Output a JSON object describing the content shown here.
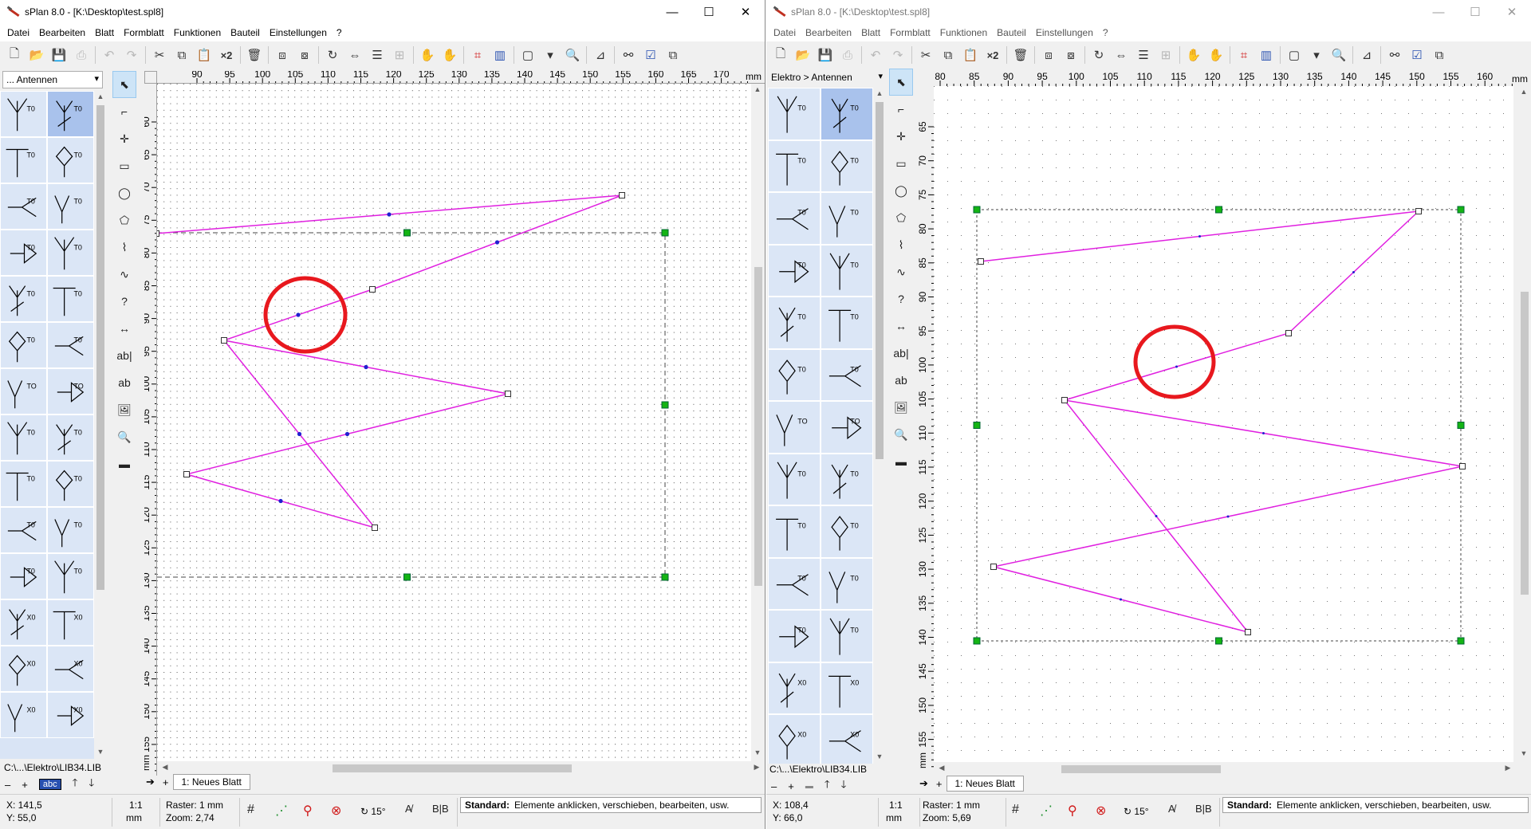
{
  "colors": {
    "polyline": "#e020e0",
    "highlight": "#e8181e",
    "handle_green": "#14b414",
    "node_blue": "#2020d0"
  },
  "menu": [
    "Datei",
    "Bearbeiten",
    "Blatt",
    "Formblatt",
    "Funktionen",
    "Bauteil",
    "Einstellungen",
    "?"
  ],
  "icons": [
    "new",
    "open",
    "save",
    "print",
    "undo",
    "redo",
    "cut",
    "copy",
    "paste",
    "duplicate",
    "delete",
    "to-front",
    "to-back",
    "rotate",
    "mirror",
    "align",
    "group",
    "ungroup",
    "snap",
    "align-grid",
    "frame",
    "zoom",
    "bom",
    "find",
    "checklist",
    "pages"
  ],
  "left": {
    "title": "sPlan 8.0 - [K:\\Desktop\\test.spl8]",
    "library": "... Antennen",
    "lib_path": "C:\\...\\Elektro\\LIB34.LIB",
    "lib_btn": "abc",
    "ruler_x": [
      "90",
      "95",
      "100",
      "105",
      "110",
      "115",
      "120",
      "125",
      "130",
      "135",
      "140",
      "145",
      "150",
      "155",
      "160",
      "165",
      "170"
    ],
    "ruler_y": [
      "60",
      "65",
      "70",
      "75",
      "80",
      "85",
      "90",
      "95",
      "100",
      "105",
      "110",
      "115",
      "120",
      "125",
      "130",
      "135",
      "140",
      "145",
      "150",
      "155"
    ],
    "unit": "mm",
    "sheet": "1: Neues Blatt",
    "coord_x": "X:    141,5",
    "coord_y": "Y:      55,0",
    "scale": "1:1",
    "scale_unit": "mm",
    "raster": "Raster: 1 mm",
    "zoom": "Zoom: 2,74",
    "angle": "15°",
    "status_label": "Standard:",
    "status_text": "Elemente anklicken, verschieben, bearbeiten, usw."
  },
  "right": {
    "title": "sPlan 8.0 - [K:\\Desktop\\test.spl8]",
    "library": "Elektro > Antennen",
    "lib_path": "C:\\...\\Elektro\\LIB34.LIB",
    "ruler_x": [
      "80",
      "85",
      "90",
      "95",
      "100",
      "105",
      "110",
      "115",
      "120",
      "125",
      "130",
      "135",
      "140",
      "145",
      "150",
      "155",
      "160"
    ],
    "ruler_y": [
      "65",
      "70",
      "75",
      "80",
      "85",
      "90",
      "95",
      "100",
      "105",
      "110",
      "115",
      "120",
      "125",
      "130",
      "135",
      "140",
      "145",
      "150",
      "155"
    ],
    "unit": "mm",
    "sheet": "1: Neues Blatt",
    "coord_x": "X:   108,4",
    "coord_y": "Y:     66,0",
    "scale": "1:1",
    "scale_unit": "mm",
    "raster": "Raster: 1 mm",
    "zoom": "Zoom: 5,69",
    "angle": "15°",
    "status_label": "Standard:",
    "status_text": "Elemente anklicken, verschieben, bearbeiten, usw."
  },
  "palette_labels": [
    [
      "T0",
      "T0"
    ],
    [
      "T0",
      "T0"
    ],
    [
      "T0",
      "T0"
    ],
    [
      "T0",
      "T0"
    ],
    [
      "T0",
      "T0"
    ],
    [
      "T0",
      "T0"
    ],
    [
      "TO",
      "TO"
    ],
    [
      "T0",
      "T0"
    ],
    [
      "T0",
      "T0"
    ],
    [
      "T0",
      "T0"
    ],
    [
      "T0",
      "T0"
    ],
    [
      "X0",
      "X0"
    ],
    [
      "X0",
      "X0"
    ],
    [
      "X0",
      "X0"
    ]
  ]
}
